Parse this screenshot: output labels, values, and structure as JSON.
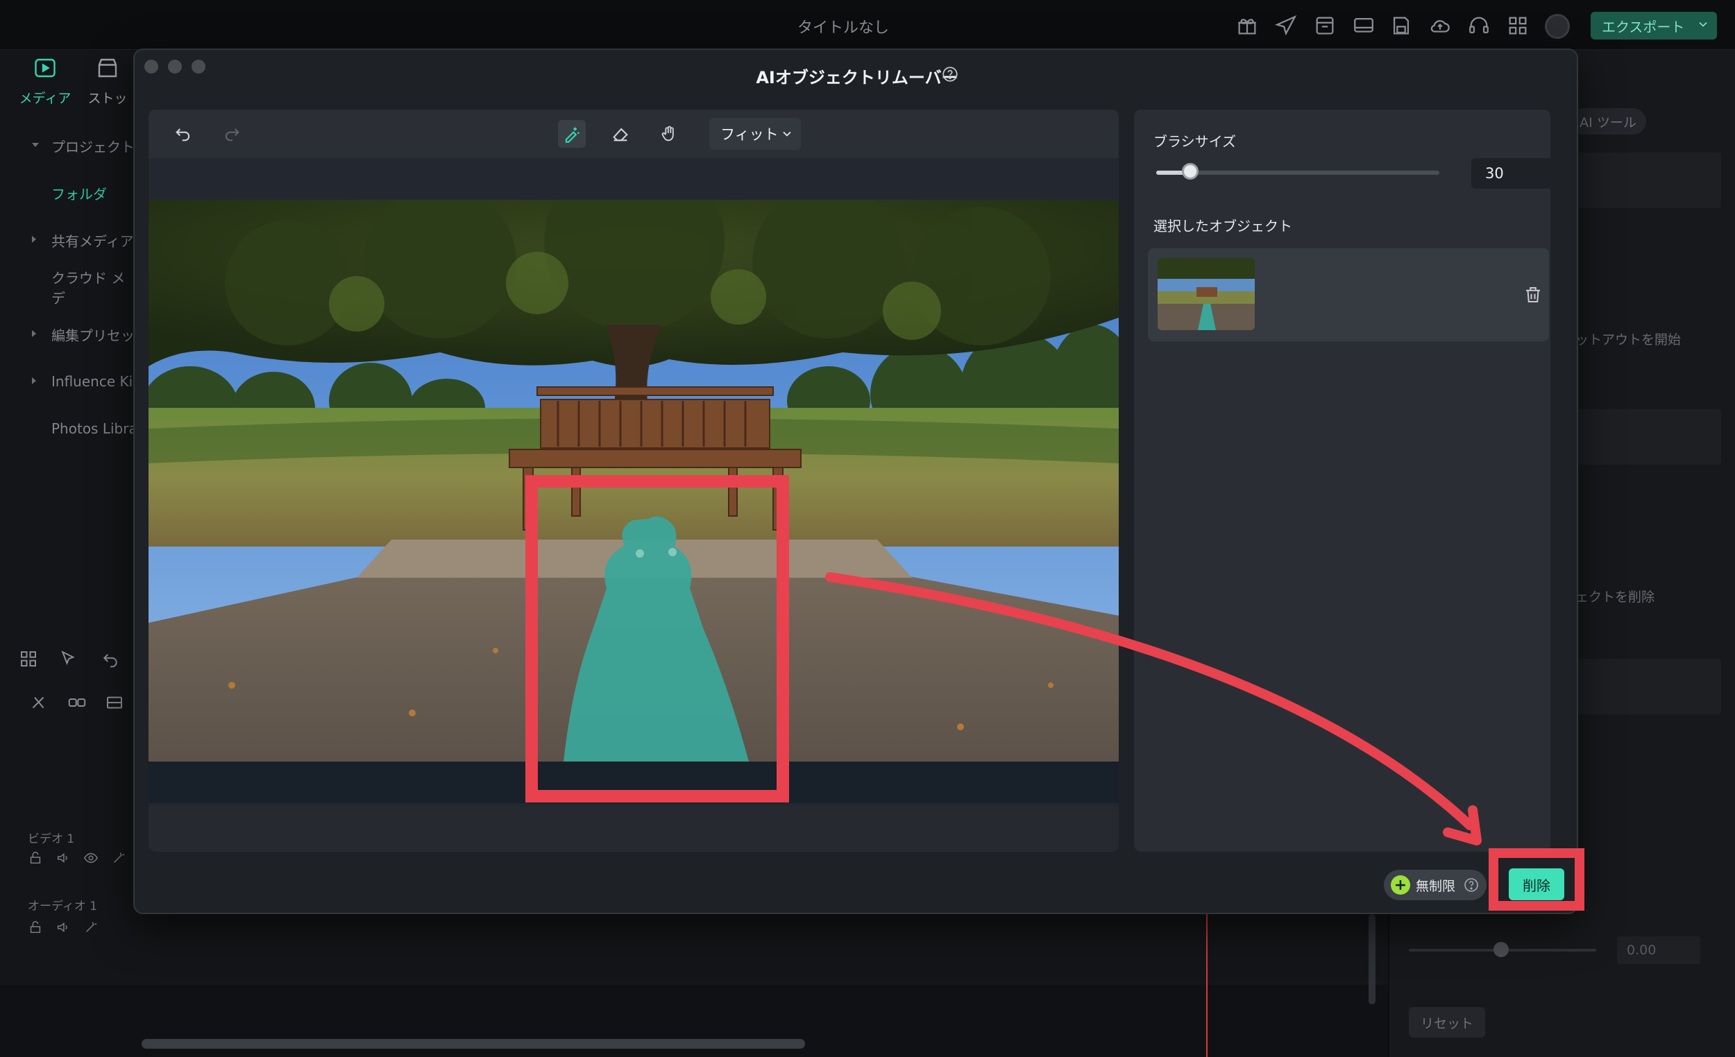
{
  "app": {
    "title": "タイトルなし",
    "export_label": "エクスポート",
    "left_tabs": [
      "メディア",
      "ストッ"
    ],
    "left_nav": [
      "プロジェクト",
      "フォルダ",
      "共有メディア",
      "クラウド メデ",
      "編集プリセッ",
      "Influence Ki",
      "Photos Libra"
    ],
    "tracks": {
      "video": "ビデオ 1",
      "audio": "オーディオ 1"
    },
    "right_panel": {
      "ai_tools_tab": "AI ツール",
      "faded_text_1": "ットアウトを開始",
      "faded_text_2": "ェクトを削除",
      "reset_label": "リセット",
      "value": "0.00"
    }
  },
  "modal": {
    "title": "AIオブジェクトリムーバー",
    "zoom": "フィット",
    "brush_size_label": "ブラシサイズ",
    "brush_size_value": "30",
    "brush_size_fraction": 0.12,
    "selected_objects_label": "選択したオブジェクト",
    "unlimited_label": "無制限",
    "remove_label": "削除"
  },
  "colors": {
    "accent": "#3fe0b8",
    "mask": "#3aa79a",
    "annotation": "#e8424f",
    "export_bg": "#1c5b49"
  },
  "icons": [
    "undo-icon",
    "redo-icon",
    "brush-icon",
    "eraser-icon",
    "hand-icon",
    "help-icon",
    "trash-icon",
    "chevron-down-icon",
    "plus-icon",
    "gift-icon",
    "send-icon",
    "save-icon",
    "cloud-icon",
    "headset-icon",
    "grid-icon"
  ]
}
